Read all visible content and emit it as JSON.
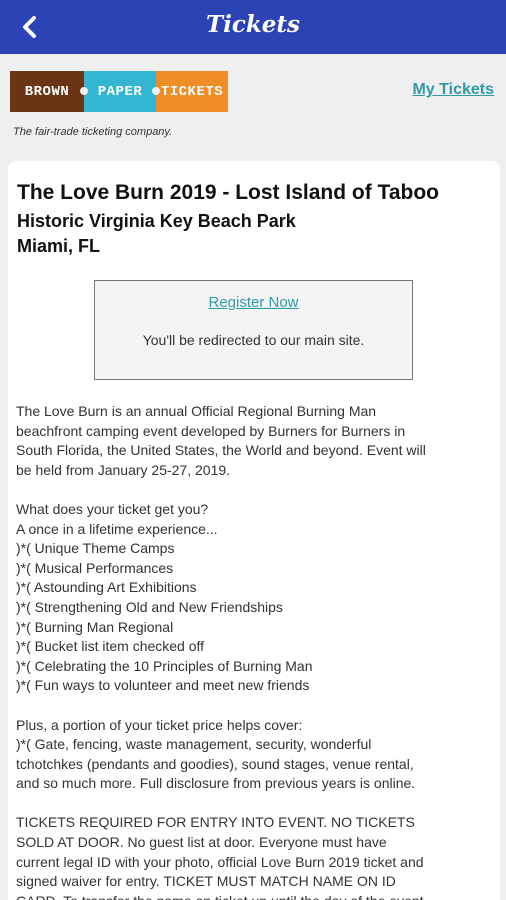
{
  "appbar": {
    "title": "Tickets",
    "back_icon": "chevron-left-icon"
  },
  "brand": {
    "logo_words": [
      "BROWN",
      "PAPER",
      "TICKETS"
    ],
    "tagline": "The fair-trade ticketing company.",
    "my_tickets_link": "My Tickets",
    "colors": {
      "brown": "#6b3414",
      "paper": "#33b6d2",
      "tickets": "#ef8e26",
      "accent": "#2c43b5"
    }
  },
  "event": {
    "title": "The Love Burn 2019 - Lost Island of Taboo",
    "venue": "Historic Virginia Key Beach Park",
    "city": "Miami, FL"
  },
  "register": {
    "link": "Register Now",
    "note": "You'll be redirected to our main site."
  },
  "description": {
    "intro": [
      "The Love Burn is an annual Official Regional Burning Man",
      "beachfront camping event developed by Burners for Burners in",
      "South Florida, the United States, the World and beyond. Event will",
      "be held from January 25-27, 2019."
    ],
    "benefits": [
      "What does your ticket get you?",
      "A once in a lifetime experience...",
      ")*( Unique Theme Camps",
      ")*( Musical Performances",
      ")*( Astounding Art Exhibitions",
      ")*( Strengthening Old and New Friendships",
      ")*( Burning Man Regional",
      ")*( Bucket list item checked off",
      ")*( Celebrating the 10 Principles of Burning Man",
      ")*( Fun ways to volunteer and meet new friends"
    ],
    "covers": [
      "Plus, a portion of your ticket price helps cover:",
      ")*( Gate, fencing, waste management, security, wonderful",
      "tchotchkes (pendants and goodies), sound stages, venue rental,",
      "and so much more.  Full disclosure from previous years is online."
    ],
    "requirements": [
      "TICKETS REQUIRED FOR ENTRY INTO EVENT. NO TICKETS",
      "SOLD AT DOOR. No guest list at door. Everyone must have",
      "current legal ID with your photo, official Love Burn 2019 ticket and",
      "signed waiver for entry. TICKET MUST MATCH NAME ON ID",
      "CARD. To transfer the name on ticket up until the day of the event"
    ]
  }
}
